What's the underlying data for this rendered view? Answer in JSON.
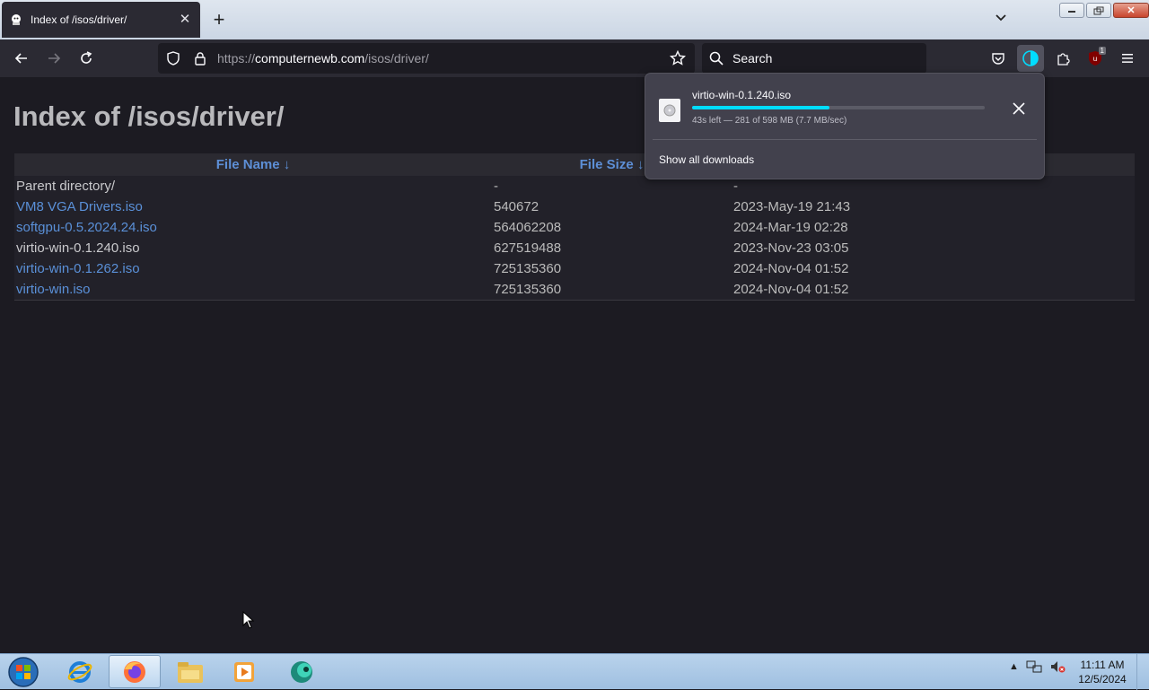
{
  "browser": {
    "tab": {
      "title": "Index of /isos/driver/"
    },
    "url": {
      "scheme": "https://",
      "host": "computernewb.com",
      "path": "/isos/driver/"
    },
    "search": {
      "placeholder": "Search"
    },
    "extension_badge": "1"
  },
  "page": {
    "heading": "Index of /isos/driver/",
    "columns": {
      "name": "File Name  ↓",
      "size": "File Size  ↓"
    },
    "rows": [
      {
        "name": "Parent directory/",
        "size": "-",
        "date": "-"
      },
      {
        "name": "VM8 VGA Drivers.iso",
        "size": "540672",
        "date": "2023-May-19 21:43"
      },
      {
        "name": "softgpu-0.5.2024.24.iso",
        "size": "564062208",
        "date": "2024-Mar-19 02:28"
      },
      {
        "name": "virtio-win-0.1.240.iso",
        "size": "627519488",
        "date": "2023-Nov-23 03:05"
      },
      {
        "name": "virtio-win-0.1.262.iso",
        "size": "725135360",
        "date": "2024-Nov-04 01:52"
      },
      {
        "name": "virtio-win.iso",
        "size": "725135360",
        "date": "2024-Nov-04 01:52"
      }
    ]
  },
  "downloads": {
    "filename": "virtio-win-0.1.240.iso",
    "status": "43s left — 281 of 598 MB (7.7 MB/sec)",
    "progress_fraction": 0.47,
    "progress_color": "#00ddff",
    "show_all": "Show all downloads"
  },
  "taskbar": {
    "time": "11:11 AM",
    "date": "12/5/2024",
    "apps": [
      "internet-explorer-icon",
      "firefox-icon",
      "file-explorer-icon",
      "media-player-icon",
      "app-icon"
    ]
  }
}
